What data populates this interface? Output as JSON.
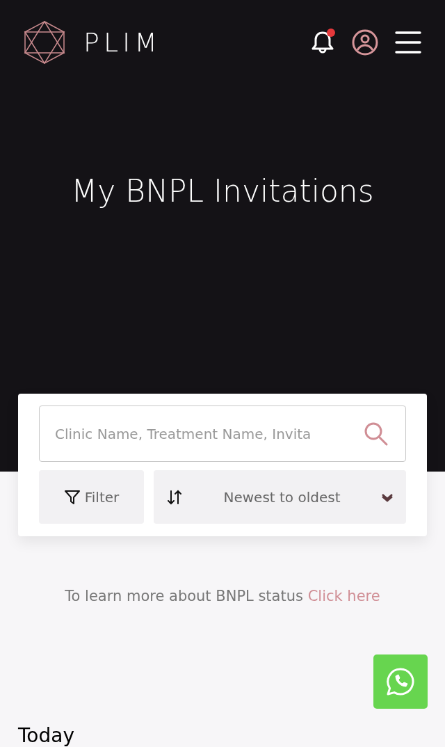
{
  "header": {
    "brand": "PLIM",
    "notifications": {
      "unread": true
    }
  },
  "hero": {
    "title": "My BNPL Invitations"
  },
  "search": {
    "placeholder": "Clinic Name, Treatment Name, Invita"
  },
  "filter_button": {
    "label": "Filter"
  },
  "sort": {
    "value": "Newest to oldest"
  },
  "info": {
    "text": "To learn more about BNPL status",
    "link": "Click here"
  },
  "section_heading": "Today"
}
